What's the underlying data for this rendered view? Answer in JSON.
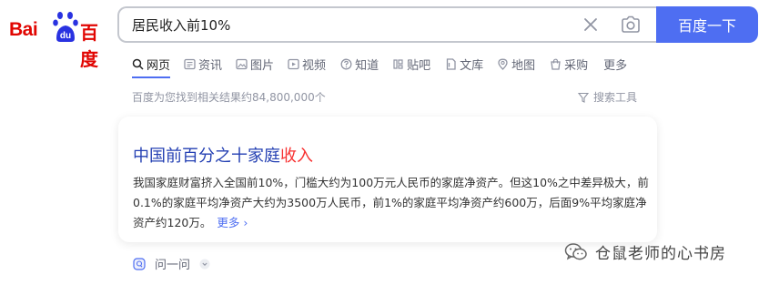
{
  "logo": {
    "text_left": "Bai",
    "paw_text": "du",
    "text_right": "百度"
  },
  "search": {
    "query": "居民收入前10%",
    "button_label": "百度一下"
  },
  "tabs": [
    {
      "label": "网页",
      "icon": "search-icon",
      "active": true
    },
    {
      "label": "资讯",
      "icon": "news-icon"
    },
    {
      "label": "图片",
      "icon": "image-icon"
    },
    {
      "label": "视频",
      "icon": "video-icon"
    },
    {
      "label": "知道",
      "icon": "question-icon"
    },
    {
      "label": "贴吧",
      "icon": "tieba-icon"
    },
    {
      "label": "文库",
      "icon": "document-icon"
    },
    {
      "label": "地图",
      "icon": "map-icon"
    },
    {
      "label": "采购",
      "icon": "shopping-icon"
    },
    {
      "label": "更多"
    }
  ],
  "result_count": "百度为您找到相关结果约84,800,000个",
  "search_tools": "搜索工具",
  "result": {
    "title_plain": "中国前百分之十家庭",
    "title_em": "收入",
    "abstract": "我国家庭财富挤入全国前10%，门槛大约为100万元人民币的家庭净资产。但这10%之中差异极大，前0.1%的家庭平均净资产大约为3500万人民币，前1%的家庭平均净资产约600万，后面9%平均家庭净资产约120万。",
    "more_label": "更多 ›"
  },
  "ask": {
    "label": "问一问"
  },
  "watermark": {
    "text": "仓鼠老师的心书房"
  },
  "colors": {
    "brand_blue": "#4e6ef2",
    "logo_red": "#e10602",
    "link_title": "#2440b3",
    "highlight_red": "#f73131"
  }
}
